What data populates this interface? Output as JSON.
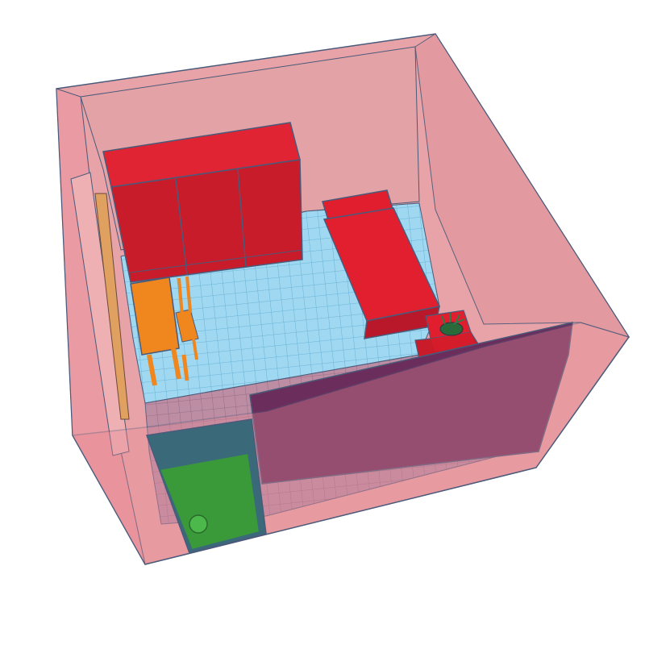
{
  "scene": {
    "objects": [
      {
        "name": "room-shell",
        "color": "#e57c8a",
        "kind": "transparent walls"
      },
      {
        "name": "floor-grid",
        "color": "#9fd6ee",
        "kind": "workplane grid"
      },
      {
        "name": "wardrobe",
        "color": "#d01c2c",
        "doors": 3
      },
      {
        "name": "bed",
        "color": "#e01e2e"
      },
      {
        "name": "nightstand",
        "color": "#e01e2e"
      },
      {
        "name": "plant",
        "color": "#2f7a4a"
      },
      {
        "name": "desk",
        "color": "#f0861e"
      },
      {
        "name": "chair",
        "color": "#f0861e"
      },
      {
        "name": "wall-panel-purple",
        "color": "#6b2e5c"
      },
      {
        "name": "door",
        "color": "#3a9a3a"
      },
      {
        "name": "door-knob",
        "color": "#4cb84c"
      },
      {
        "name": "side-window",
        "color": "#e0a060"
      }
    ]
  }
}
